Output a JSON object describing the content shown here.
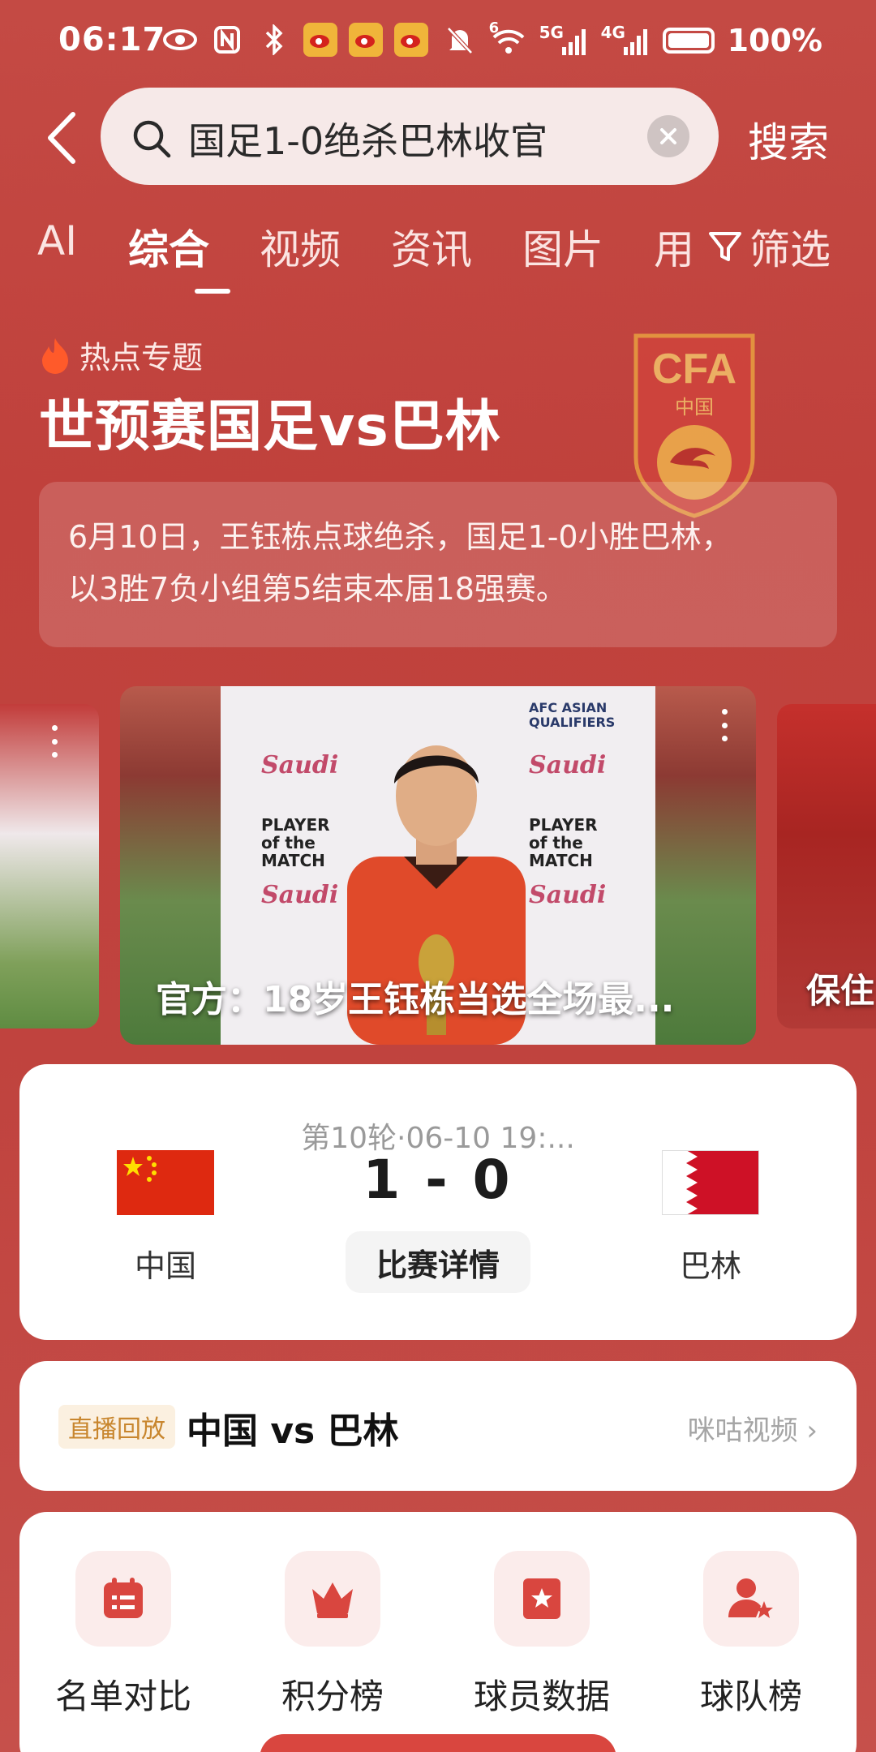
{
  "status_bar": {
    "time": "06:17",
    "net_5g": "5G",
    "net_4g": "4G",
    "wifi_badge": "6",
    "battery": "100%"
  },
  "search": {
    "query": "国足1-0绝杀巴林收官",
    "button": "搜索"
  },
  "tabs": [
    {
      "label": "AI"
    },
    {
      "label": "综合"
    },
    {
      "label": "视频"
    },
    {
      "label": "资讯"
    },
    {
      "label": "图片"
    },
    {
      "label": "用"
    },
    {
      "label": "筛选"
    }
  ],
  "topic": {
    "hot_label": "热点专题",
    "title": "世预赛国足vs巴林",
    "logo_text": "CFA",
    "logo_sub": "中国",
    "description_line1": "6月10日，王钰栋点球绝杀，国足1-0小胜巴林，",
    "description_line2": "以3胜7负小组第5结束本届18强赛。"
  },
  "carousel": {
    "main_caption": "官方：18岁王钰栋当选全场最...",
    "right_caption": "保住",
    "backdrop_sponsor": "Saudi",
    "backdrop_pom": "PLAYER of the MATCH",
    "backdrop_afc": "AFC ASIAN QUALIFIERS"
  },
  "match": {
    "round": "第10轮·06-10 19:...",
    "score": "1 - 0",
    "home": "中国",
    "away": "巴林",
    "detail_button": "比赛详情"
  },
  "replay": {
    "badge": "直播回放",
    "title": "中国 vs 巴林",
    "source": "咪咕视频 ›"
  },
  "quick_entries": [
    {
      "label": "名单对比",
      "icon": "calendar-list-icon"
    },
    {
      "label": "积分榜",
      "icon": "crown-icon"
    },
    {
      "label": "球员数据",
      "icon": "star-card-icon"
    },
    {
      "label": "球队榜",
      "icon": "user-star-icon"
    }
  ],
  "colors": {
    "background": "#c0413c",
    "accent_red": "#d9463f",
    "badge_gold": "#c8862e"
  }
}
